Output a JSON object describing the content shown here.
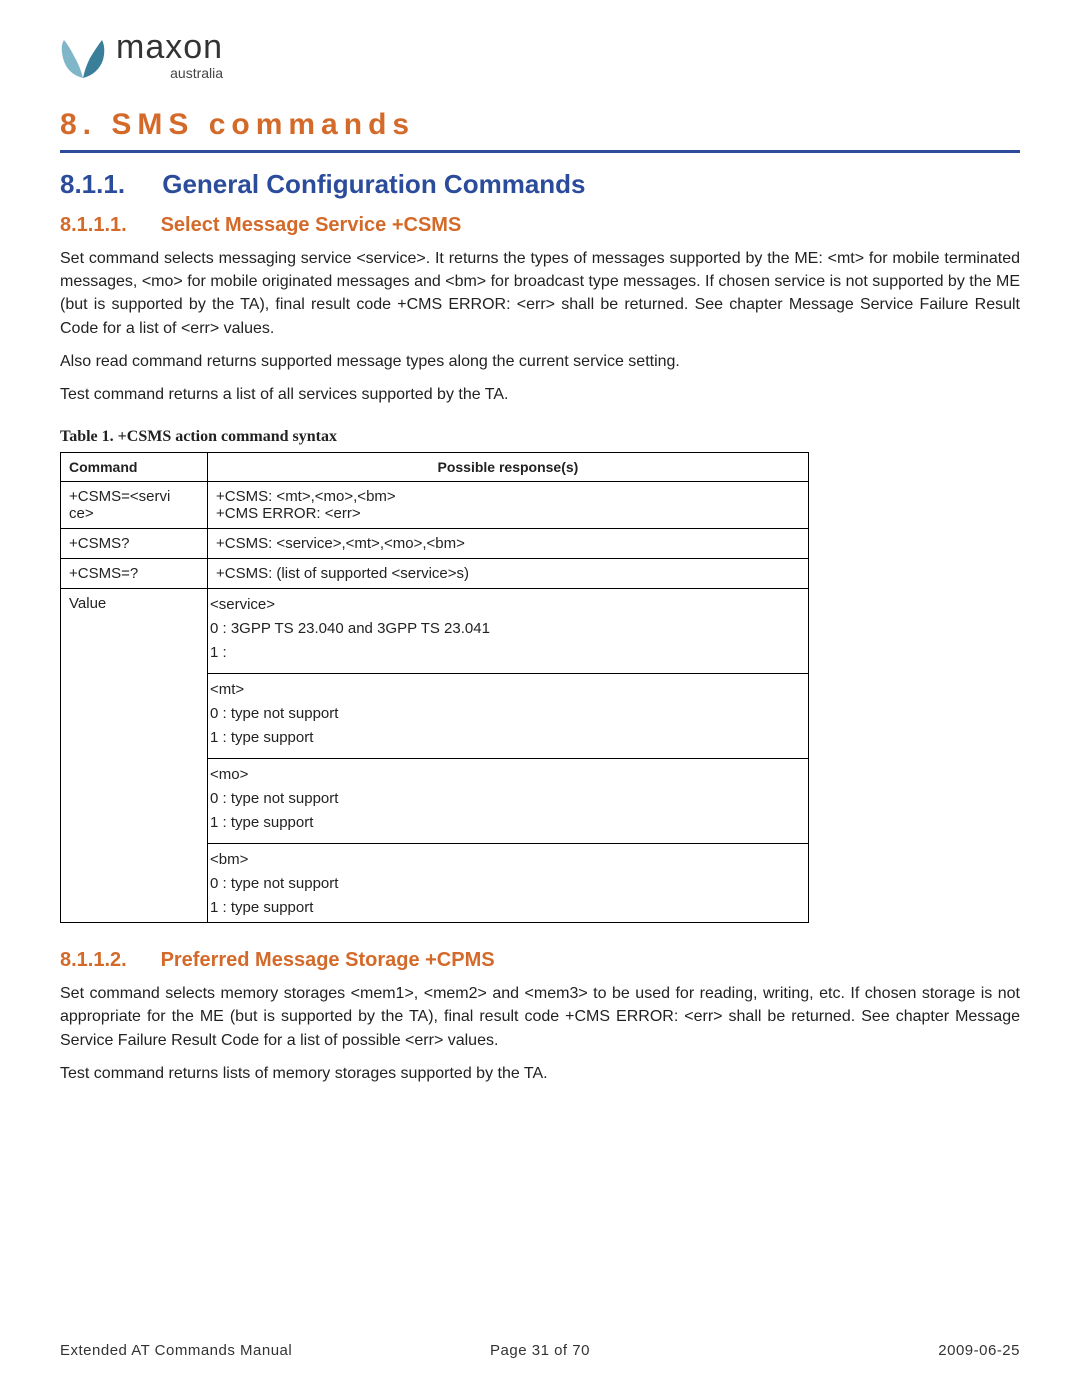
{
  "logo": {
    "brand": "maxon",
    "sub": "australia"
  },
  "headings": {
    "h1": "8.  SMS commands",
    "h2_num": "8.1.1.",
    "h2_text": "General Configuration Commands",
    "h3a_num": "8.1.1.1.",
    "h3a_text": "Select Message Service +CSMS",
    "h3b_num": "8.1.1.2.",
    "h3b_text": "Preferred Message Storage +CPMS"
  },
  "para": {
    "csms_p1": "Set command selects messaging service <service>. It returns the types of messages supported by the ME: <mt> for mobile terminated messages, <mo> for mobile originated messages and <bm> for broadcast type messages. If chosen service is not supported by the ME (but is supported by the TA), final result code +CMS ERROR: <err> shall be returned. See chapter Message Service Failure Result Code for a list of <err> values.",
    "csms_p2": "Also read command returns supported message types along the current service setting.",
    "csms_p3": "Test command returns a list of all services supported by the TA.",
    "cpms_p1": "Set command selects memory storages <mem1>, <mem2> and <mem3> to be used for reading, writing, etc. If chosen storage is not appropriate for the ME (but is supported by the TA), final result code +CMS ERROR: <err> shall be returned. See chapter Message Service Failure Result Code for a list of possible <err> values.",
    "cpms_p2": "Test command returns lists of memory storages supported by the TA."
  },
  "table1": {
    "caption": "Table 1. +CSMS action command syntax",
    "head_cmd": "Command",
    "head_resp": "Possible response(s)",
    "row1_cmd_l1": "+CSMS=<servi",
    "row1_cmd_l2": "ce>",
    "row1_resp_l1": "+CSMS: <mt>,<mo>,<bm>",
    "row1_resp_l2": "+CMS ERROR: <err>",
    "row2_cmd": "+CSMS?",
    "row2_resp": "+CSMS: <service>,<mt>,<mo>,<bm>",
    "row3_cmd": "+CSMS=?",
    "row3_resp": "+CSMS: (list of supported <service>s)",
    "row4_cmd": "Value",
    "value_groups": {
      "service": {
        "tag": "<service>",
        "l0": "0 : 3GPP TS 23.040  and 3GPP TS 23.041",
        "l1": "1 :"
      },
      "mt": {
        "tag": "<mt>",
        "l0": "0 : type not support",
        "l1": "1 : type support"
      },
      "mo": {
        "tag": "<mo>",
        "l0": "0 : type not support",
        "l1": "1 : type support"
      },
      "bm": {
        "tag": "<bm>",
        "l0": "0 : type not support",
        "l1": "1 : type support"
      }
    }
  },
  "footer": {
    "left": "Extended AT Commands Manual",
    "center": "Page 31 of 70",
    "right": "2009-06-25"
  }
}
